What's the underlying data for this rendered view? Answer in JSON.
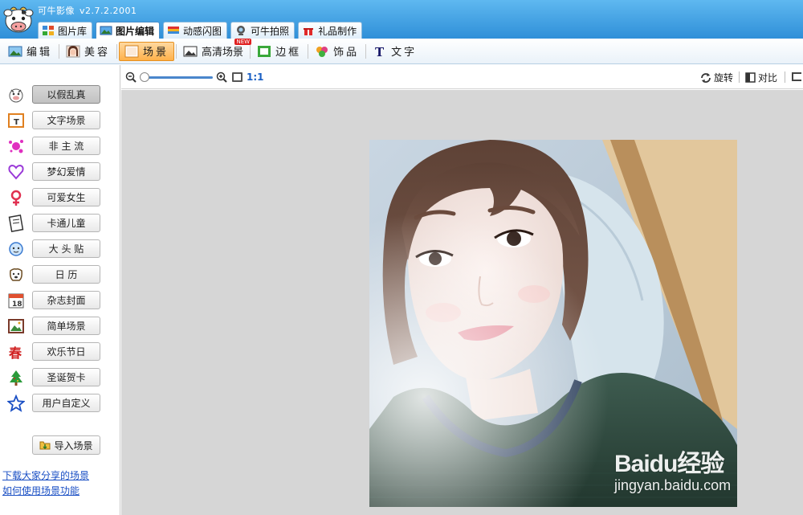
{
  "app": {
    "title": "可牛影像",
    "version": "v2.7.2.2001",
    "accent_color": "#2f8fd8"
  },
  "main_tabs": [
    {
      "label": "图片库",
      "icon": "gallery-icon"
    },
    {
      "label": "图片编辑",
      "icon": "photo-edit-icon",
      "active": true
    },
    {
      "label": "动感闪图",
      "icon": "flash-image-icon"
    },
    {
      "label": "可牛拍照",
      "icon": "webcam-icon"
    },
    {
      "label": "礼品制作",
      "icon": "gift-icon"
    }
  ],
  "edit_tabs": [
    {
      "label": "编辑",
      "icon": "landscape-icon"
    },
    {
      "label": "美容",
      "icon": "face-icon"
    },
    {
      "label": "场景",
      "icon": "scene-icon",
      "active": true
    },
    {
      "label": "高清场景",
      "icon": "hd-scene-icon",
      "badge": "NEW"
    },
    {
      "label": "边框",
      "icon": "frame-icon"
    },
    {
      "label": "饰品",
      "icon": "clover-icon"
    },
    {
      "label": "文字",
      "icon": "text-icon"
    }
  ],
  "scene_categories": [
    {
      "label": "以假乱真",
      "icon": "cow-icon",
      "active": true
    },
    {
      "label": "文字场景",
      "icon": "text-scene-icon"
    },
    {
      "label": "非 主 流",
      "icon": "splash-icon"
    },
    {
      "label": "梦幻爱情",
      "icon": "heart-icon"
    },
    {
      "label": "可爱女生",
      "icon": "female-icon"
    },
    {
      "label": "卡通儿童",
      "icon": "book-icon"
    },
    {
      "label": "大 头 贴",
      "icon": "face-sticker-icon"
    },
    {
      "label": "日  历",
      "icon": "dog-icon"
    },
    {
      "label": "杂志封面",
      "icon": "calendar-icon"
    },
    {
      "label": "简单场景",
      "icon": "frame-scene-icon"
    },
    {
      "label": "欢乐节日",
      "icon": "spring-icon"
    },
    {
      "label": "圣诞贺卡",
      "icon": "christmas-tree-icon"
    },
    {
      "label": "用户自定义",
      "icon": "star-icon"
    }
  ],
  "left_panel": {
    "import_label": "导入场景",
    "link_download": "下载大家分享的场景",
    "link_help": "如何使用场景功能"
  },
  "toolbar": {
    "ratio_label": "1:1",
    "rotate_label": "旋转",
    "compare_label": "对比",
    "zoom_level": 0.05
  },
  "watermark": {
    "main": "Baidu经验",
    "sub": "jingyan.baidu.com"
  }
}
